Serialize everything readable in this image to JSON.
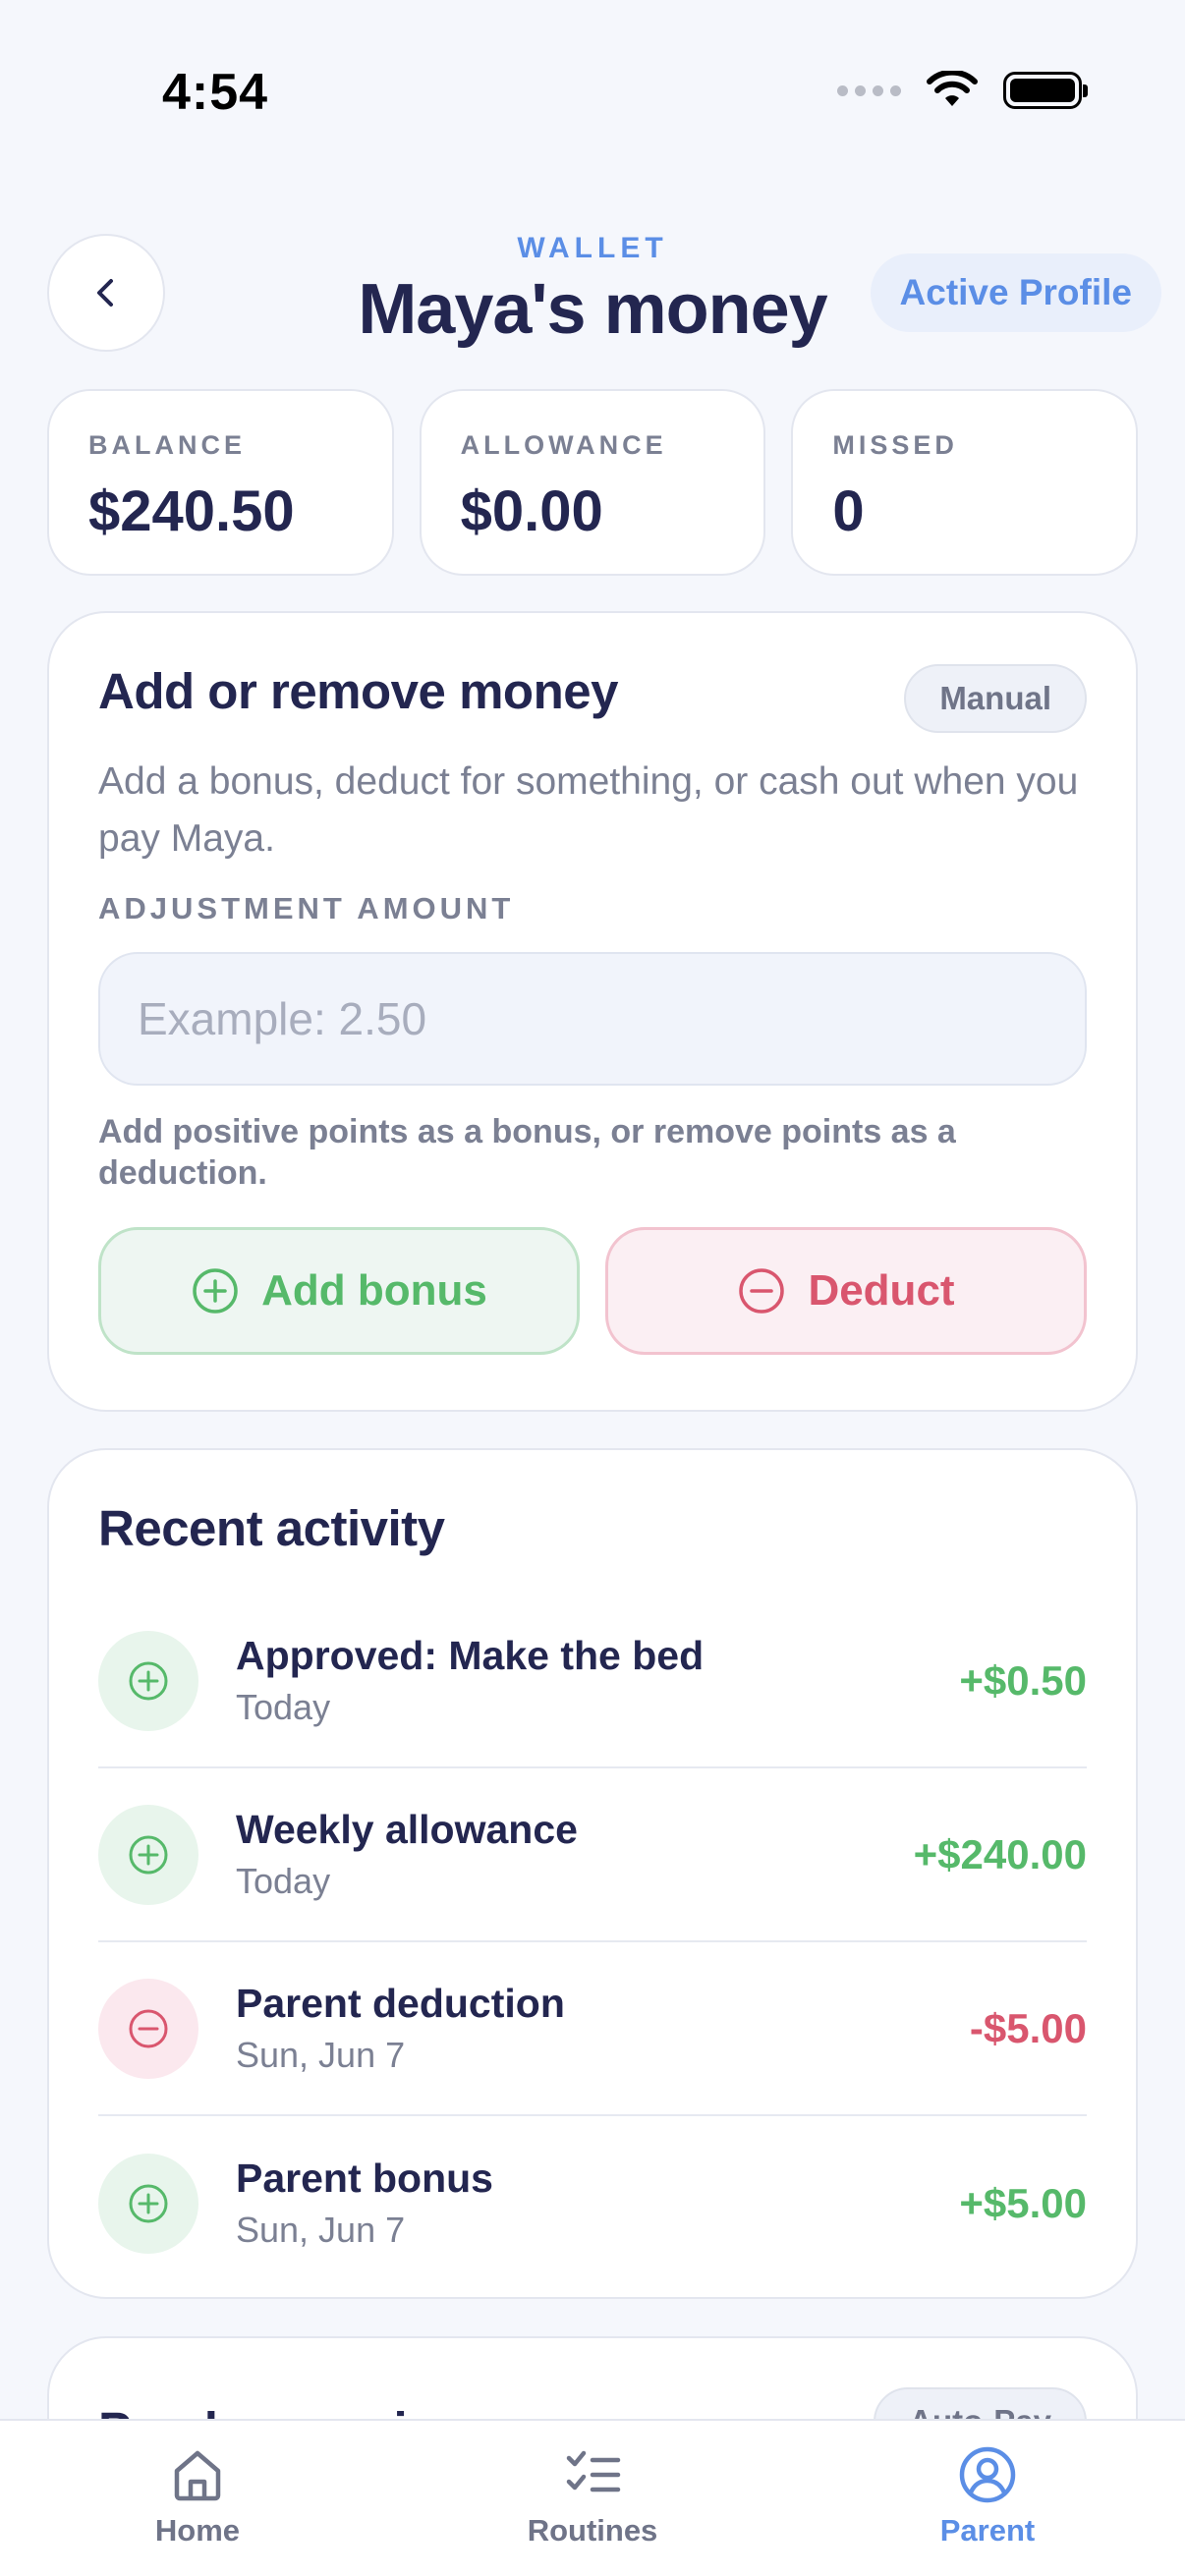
{
  "status_bar": {
    "time": "4:54"
  },
  "header": {
    "eyebrow": "WALLET",
    "title": "Maya's money",
    "profile_pill": "Active Profile"
  },
  "stats": [
    {
      "label": "BALANCE",
      "value": "$240.50"
    },
    {
      "label": "ALLOWANCE",
      "value": "$0.00"
    },
    {
      "label": "MISSED",
      "value": "0"
    }
  ],
  "adjust": {
    "title": "Add or remove money",
    "badge": "Manual",
    "description": "Add a bonus, deduct for something, or cash out when you pay Maya.",
    "field_label": "ADJUSTMENT AMOUNT",
    "input_value": "",
    "input_placeholder": "Example: 2.50",
    "hint": "Add positive points as a bonus, or remove points as a deduction.",
    "bonus_button": "Add bonus",
    "deduct_button": "Deduct"
  },
  "activity": {
    "title": "Recent activity",
    "items": [
      {
        "title": "Approved: Make the bed",
        "date": "Today",
        "amount": "+$0.50",
        "kind": "plus"
      },
      {
        "title": "Weekly allowance",
        "date": "Today",
        "amount": "+$240.00",
        "kind": "plus"
      },
      {
        "title": "Parent deduction",
        "date": "Sun, Jun 7",
        "amount": "-$5.00",
        "kind": "minus"
      },
      {
        "title": "Parent bonus",
        "date": "Sun, Jun 7",
        "amount": "+$5.00",
        "kind": "plus"
      }
    ]
  },
  "payday": {
    "title": "Payday preview",
    "badge": "Auto-Pay"
  },
  "tabs": [
    {
      "label": "Home",
      "icon": "home-icon"
    },
    {
      "label": "Routines",
      "icon": "checklist-icon"
    },
    {
      "label": "Parent",
      "icon": "user-circle-icon",
      "active": true
    }
  ],
  "colors": {
    "accent_blue": "#5b8ee6",
    "positive_green": "#56b96a",
    "negative_red": "#d9566e",
    "ink": "#232650",
    "muted": "#7b8093",
    "background": "#f5f7fc"
  }
}
